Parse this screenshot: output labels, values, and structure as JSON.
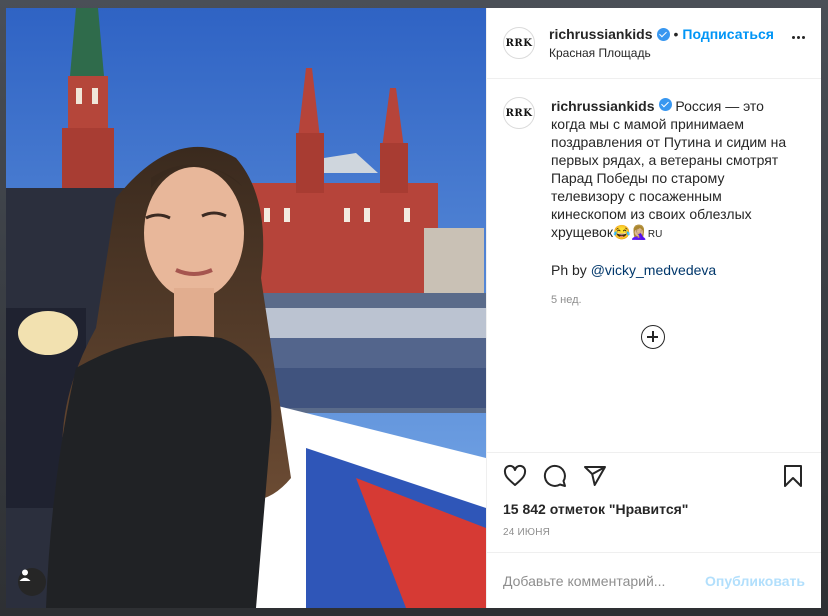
{
  "post": {
    "username": "richrussiankids",
    "separator": "•",
    "follow_label": "Подписаться",
    "location": "Красная Площадь",
    "avatar_text": "RRK",
    "caption_text": "Россия — это когда мы с мамой принимаем поздравления от Путина и сидим на первых рядах, а ветераны смотрят Парад Победы по старому телевизору с посаженным кинескопом из своих облезлых хрущевок😂🤦🏼‍♀️",
    "caption_suffix": "RU",
    "credit_prefix": "Ph by ",
    "credit_mention": "@vicky_medvedeva",
    "age": "5 нед.",
    "likes": "15 842 отметок \"Нравится\"",
    "date": "24 ИЮНЯ"
  },
  "comment": {
    "placeholder": "Добавьте комментарий...",
    "publish_label": "Опубликовать"
  },
  "icons": {
    "like": "heart-icon",
    "comment": "comment-icon",
    "share": "share-icon",
    "save": "bookmark-icon",
    "more": "more-options-icon",
    "tag": "user-tag-icon",
    "load_more": "plus-circle-icon"
  },
  "colors": {
    "accent": "#0095f6",
    "verified": "#3897f0",
    "publish_disabled": "#b2dffc"
  }
}
